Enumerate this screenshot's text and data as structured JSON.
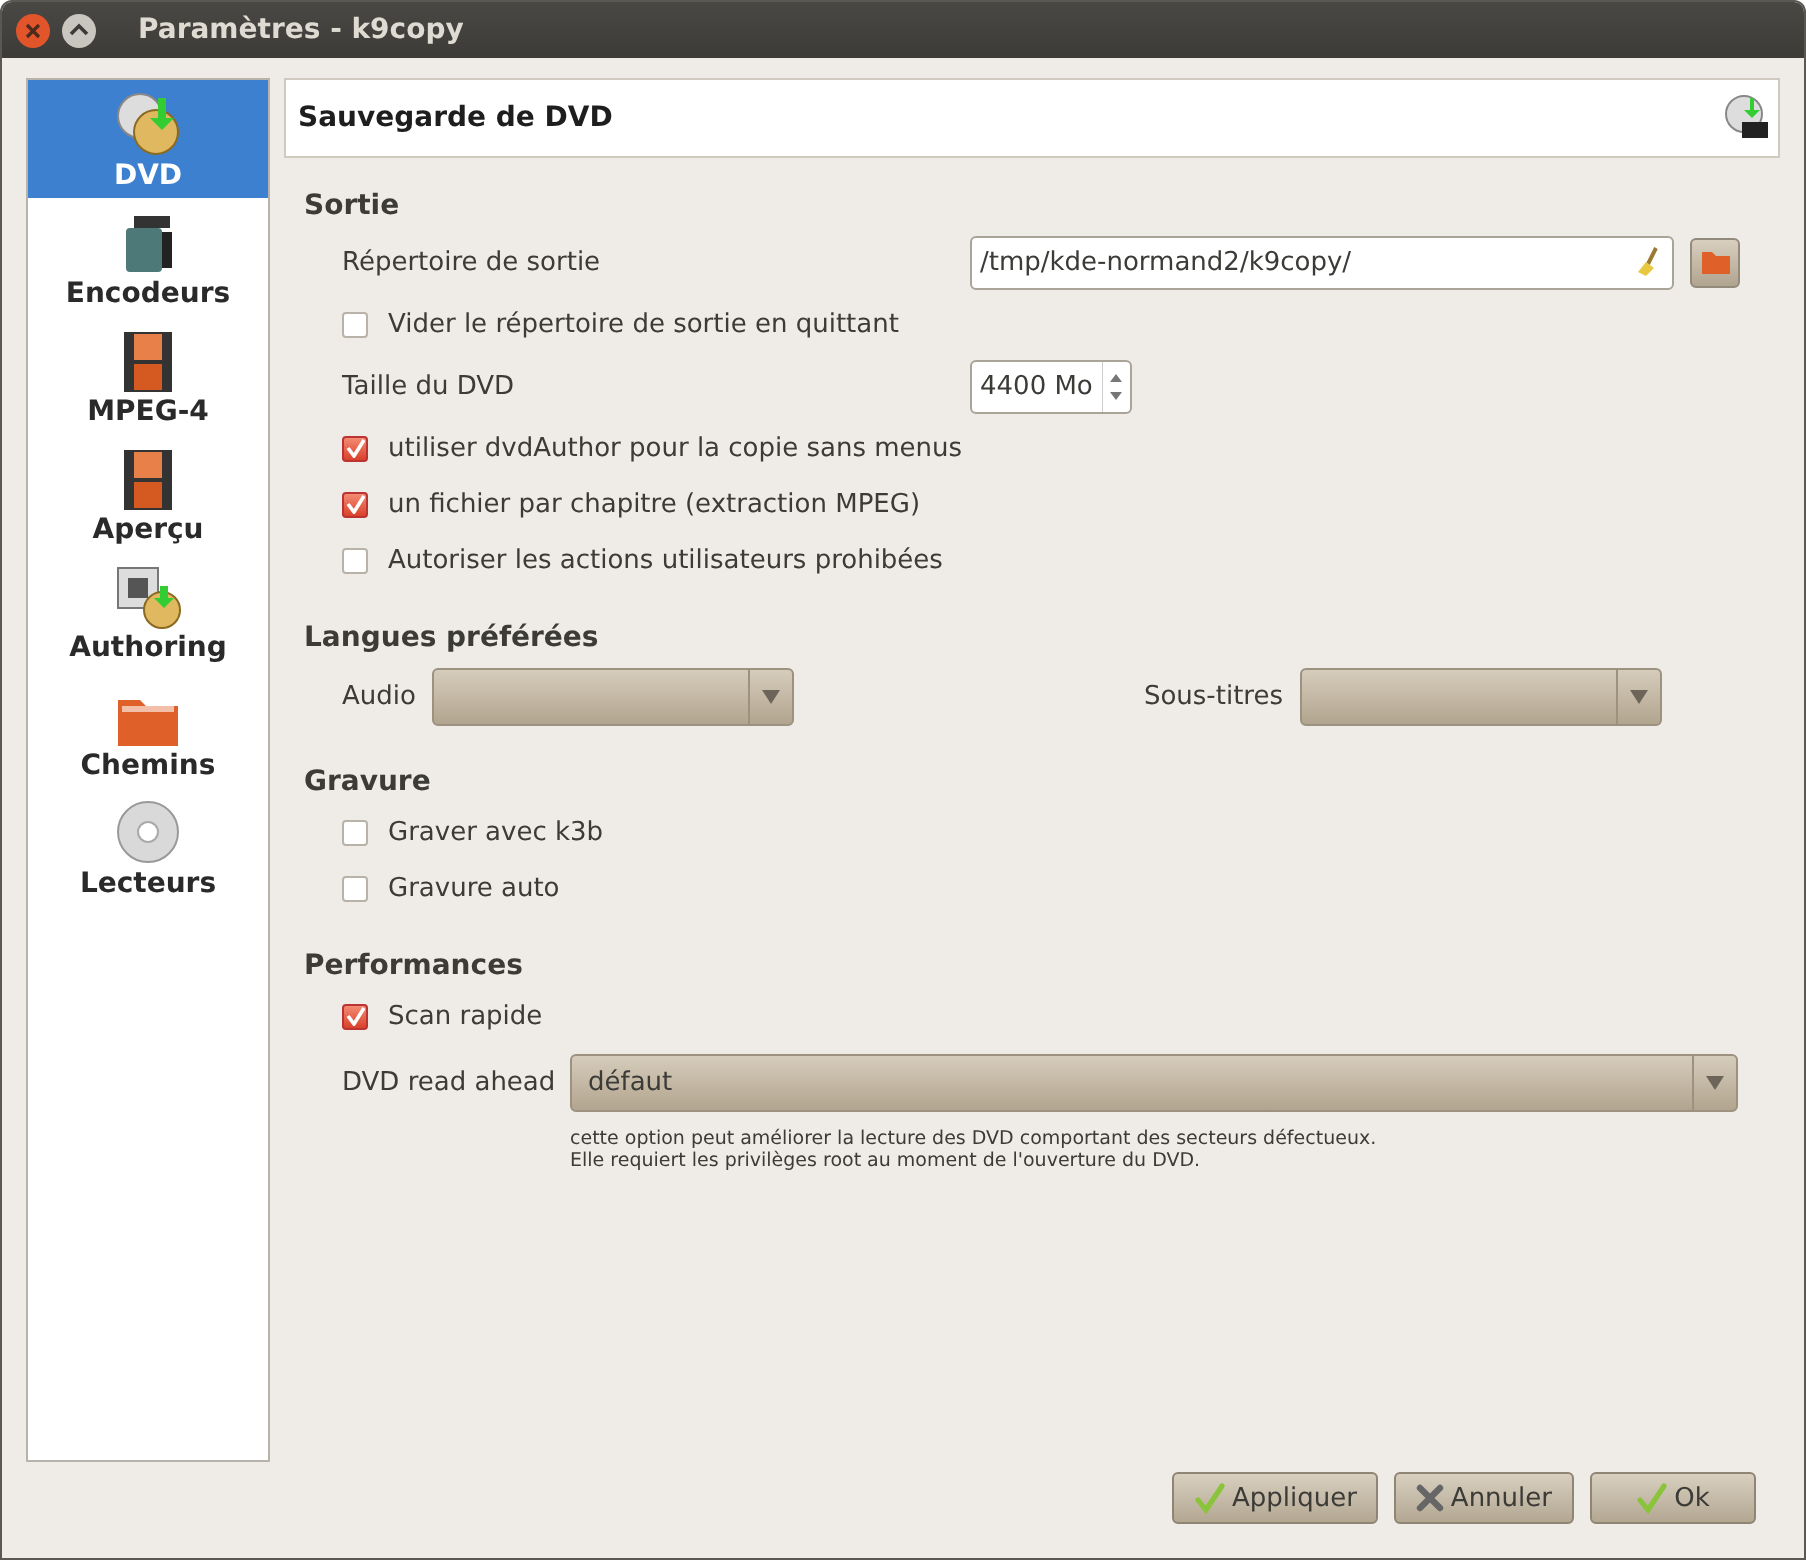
{
  "window": {
    "title": "Paramètres - k9copy"
  },
  "sidebar": {
    "items": [
      {
        "label": "DVD",
        "selected": true
      },
      {
        "label": "Encodeurs",
        "selected": false
      },
      {
        "label": "MPEG-4",
        "selected": false
      },
      {
        "label": "Aperçu",
        "selected": false
      },
      {
        "label": "Authoring",
        "selected": false
      },
      {
        "label": "Chemins",
        "selected": false
      },
      {
        "label": "Lecteurs",
        "selected": false
      }
    ]
  },
  "page_header": {
    "title": "Sauvegarde de DVD"
  },
  "sections": [
    {
      "title": "Sortie",
      "rows": [
        {
          "kind": "path",
          "label": "Répertoire de sortie",
          "value": "/tmp/kde-normand2/k9copy/"
        },
        {
          "kind": "checkbox",
          "label": "Vider le répertoire de sortie en quittant",
          "checked": false
        },
        {
          "kind": "spin",
          "label": "Taille du DVD",
          "value": "4400 Mo"
        },
        {
          "kind": "checkbox",
          "label": "utiliser dvdAuthor pour la copie sans menus",
          "checked": true
        },
        {
          "kind": "checkbox",
          "label": "un fichier par chapitre (extraction MPEG)",
          "checked": true
        },
        {
          "kind": "checkbox",
          "label": "Autoriser les actions utilisateurs prohibées",
          "checked": false
        }
      ]
    },
    {
      "title": "Langues préférées",
      "rows": [
        {
          "kind": "combos",
          "items": [
            {
              "label": "Audio"
            },
            {
              "label": "Sous-titres"
            }
          ]
        }
      ]
    },
    {
      "title": "Gravure",
      "rows": [
        {
          "kind": "checkbox",
          "label": "Graver avec k3b",
          "checked": false
        },
        {
          "kind": "checkbox",
          "label": "Gravure auto",
          "checked": false
        }
      ]
    },
    {
      "title": "Performances",
      "rows": [
        {
          "kind": "checkbox",
          "label": "Scan rapide",
          "checked": true
        },
        {
          "kind": "combo",
          "label": "DVD read ahead",
          "value": "défaut"
        },
        {
          "kind": "note",
          "lines": [
            "cette option peut améliorer la lecture des DVD comportant des secteurs défectueux.",
            "Elle requiert les privilèges root au moment de l'ouverture du DVD."
          ]
        }
      ]
    }
  ],
  "buttons": [
    {
      "kind": "apply",
      "label": "Appliquer"
    },
    {
      "kind": "cancel",
      "label": "Annuler"
    },
    {
      "kind": "ok",
      "label": "Ok"
    }
  ]
}
